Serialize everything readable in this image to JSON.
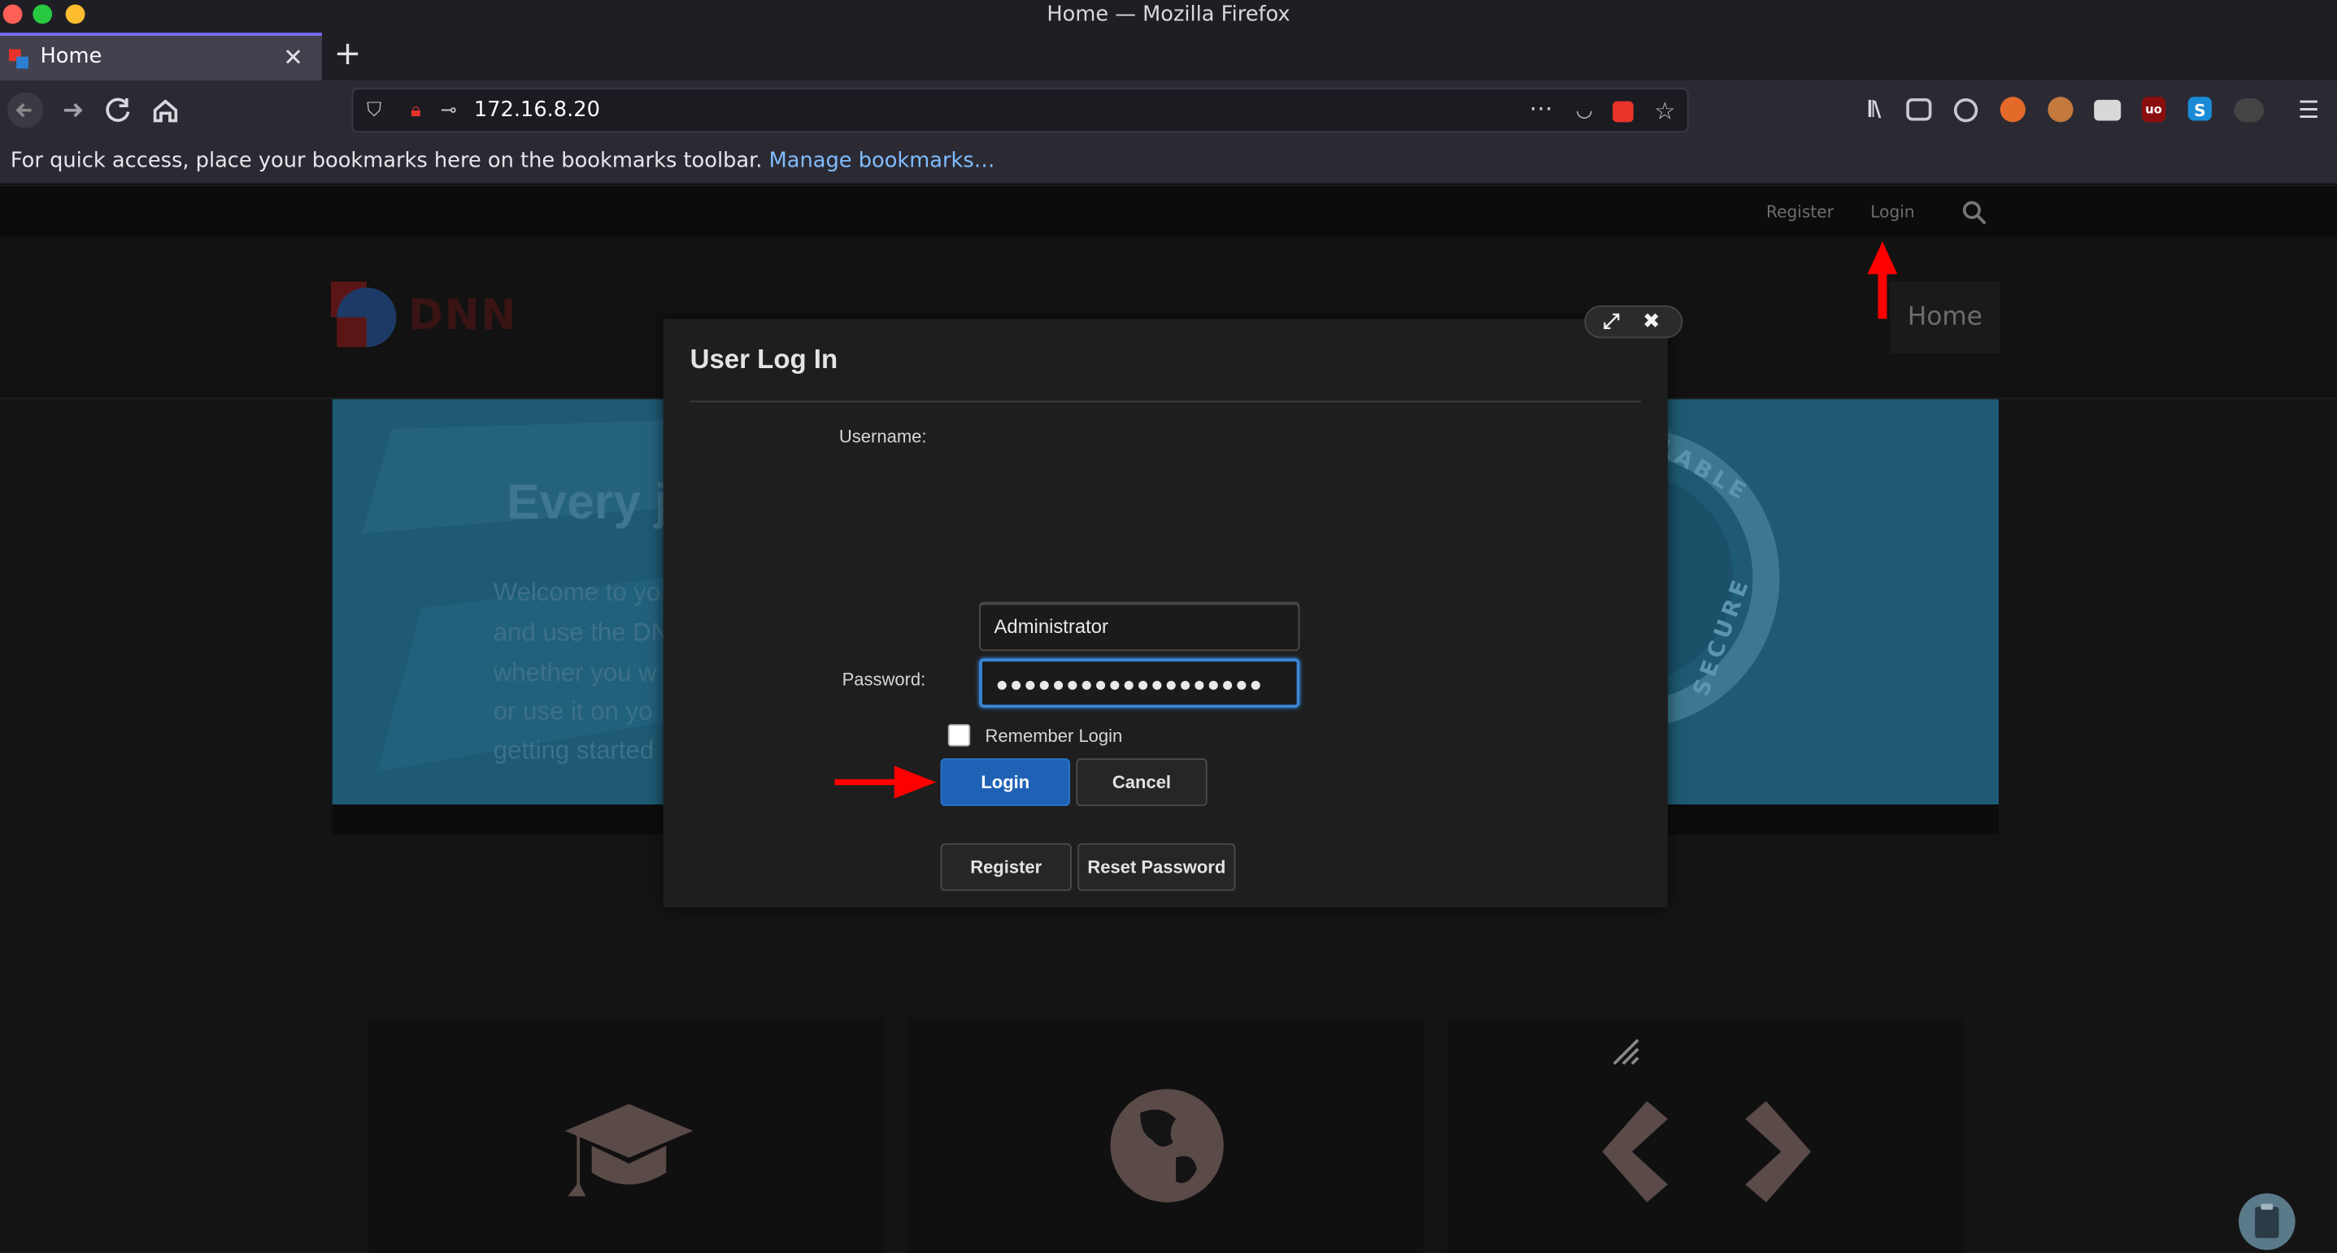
{
  "window": {
    "title": "Home — Mozilla Firefox"
  },
  "tabs": [
    {
      "label": "Home",
      "active": true
    }
  ],
  "address_bar": {
    "url": "172.16.8.20"
  },
  "bookmarks_bar": {
    "message": "For quick access, place your bookmarks here on the bookmarks toolbar.",
    "link": "Manage bookmarks…"
  },
  "site": {
    "top_links": {
      "register": "Register",
      "login": "Login"
    },
    "logo_text": "DNN",
    "nav": {
      "home": "Home"
    },
    "hero": {
      "title": "Every journey begins with the first step",
      "lines": [
        "Welcome to yo",
        "and use the DN",
        "whether you w",
        "or use it on yo",
        "getting started"
      ],
      "badge_text": [
        "SCALABLE",
        "SECURE"
      ]
    }
  },
  "login_dialog": {
    "title": "User Log In",
    "username_label": "Username:",
    "username_value": "Administrator",
    "password_label": "Password:",
    "password_value": "●●●●●●●●●●●●●●●●●●●",
    "remember_label": "Remember Login",
    "remember_checked": false,
    "login_button": "Login",
    "cancel_button": "Cancel",
    "register_button": "Register",
    "reset_button": "Reset Password"
  },
  "colors": {
    "firefox_toolbar": "#2b2a33",
    "hero_blue": "#1e5a73",
    "primary_button": "#1f61b4",
    "annotation_arrow": "#ff0000"
  },
  "icons": {
    "toolbar_right": [
      "library-icon",
      "sidebar-icon",
      "account-icon",
      "extension-icon",
      "cookie-icon",
      "extension-icon",
      "ublock-icon",
      "skype-icon",
      "extension-icon",
      "menu-icon"
    ]
  }
}
